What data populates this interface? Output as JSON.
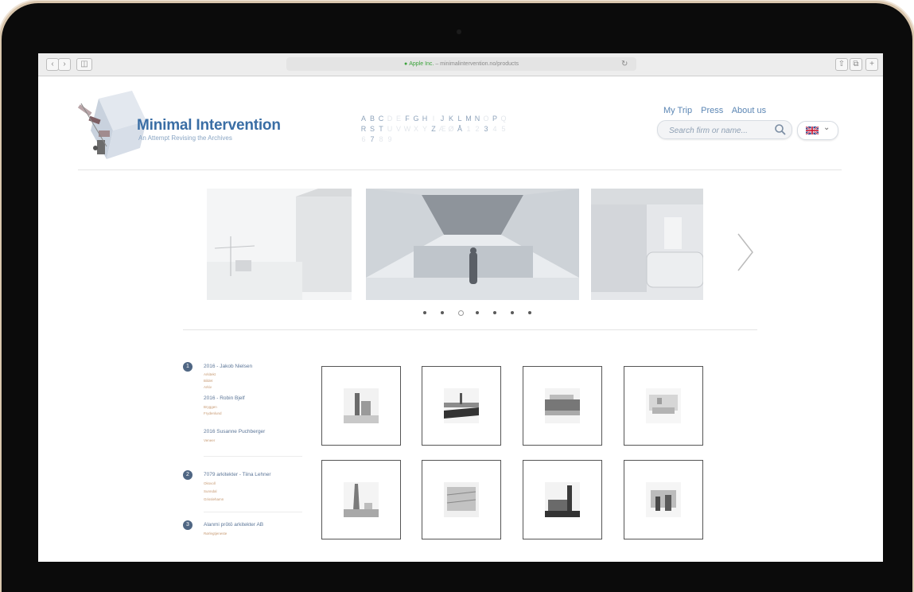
{
  "browser": {
    "url_secure": "Apple Inc.",
    "url_path": "minimalintervention.no/products",
    "back_icon": "back-icon",
    "forward_icon": "forward-icon",
    "sidebar_icon": "sidebar-icon",
    "reload_icon": "reload-icon",
    "share_icon": "share-icon",
    "tabs_icon": "tabs-icon"
  },
  "site": {
    "title": "Minimal Intervention",
    "tagline": "An Attempt Revising the Archives",
    "accent_color": "#3a6ea5"
  },
  "alphabet": {
    "row1": [
      "A",
      "B",
      "C",
      "D",
      "E",
      "F",
      "G",
      "H",
      "I",
      "J",
      "K",
      "L",
      "M",
      "N",
      "O",
      "P",
      "Q"
    ],
    "row2": [
      "R",
      "S",
      "T",
      "U",
      "V",
      "W",
      "X",
      "Y",
      "Z",
      "Æ",
      "Ø",
      "Å",
      "1",
      "2",
      "3",
      "4",
      "5"
    ],
    "row3": [
      "6",
      "7",
      "8",
      "9"
    ],
    "active_row1": [
      true,
      true,
      true,
      false,
      false,
      true,
      true,
      true,
      false,
      true,
      true,
      true,
      true,
      true,
      false,
      true,
      false
    ],
    "active_row2": [
      true,
      true,
      true,
      false,
      false,
      false,
      false,
      false,
      true,
      false,
      false,
      true,
      false,
      false,
      true,
      false,
      false
    ],
    "active_row3": [
      false,
      true,
      false,
      false
    ]
  },
  "nav": {
    "items": [
      "My Trip",
      "Press",
      "About us"
    ]
  },
  "search": {
    "placeholder": "Search firm or name...",
    "icon": "search-icon"
  },
  "language": {
    "flag": "uk-flag-icon",
    "chevron": "chevron-down-icon"
  },
  "carousel": {
    "dot_count": 7,
    "active_index": 2,
    "next_icon": "chevron-right-icon"
  },
  "groups": [
    {
      "number": "1",
      "entries": [
        {
          "title": "2016 - Jakob Nielsen",
          "subs": [
            "Arkitekt",
            "Bildet",
            "Arkiv"
          ]
        },
        {
          "title": "2016 - Robin Bjelf",
          "subs": [
            "Bryggen",
            "Frydenlund"
          ]
        },
        {
          "title": "2016 Susanne Puchberger",
          "subs": [
            "Veneer"
          ]
        }
      ]
    },
    {
      "number": "2",
      "entries": [
        {
          "title": "7079 arkitekter - Tiina Lehner",
          "subs": [
            "Oksvoll",
            "Sunndal",
            "Grisslehamn"
          ]
        }
      ]
    },
    {
      "number": "3",
      "entries": [
        {
          "title": "Alanmi prōtō arkitekter AB",
          "subs": [
            "Rørlegtjeneste"
          ]
        }
      ]
    }
  ]
}
